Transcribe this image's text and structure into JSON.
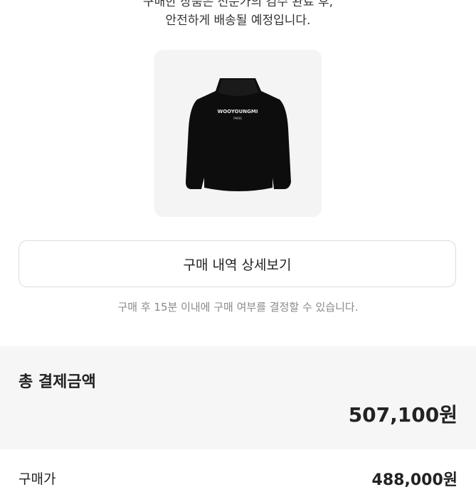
{
  "message": {
    "line1": "구매한 상품은 전문가의 검수 완료 후,",
    "line2": "안전하게 배송될 예정입니다."
  },
  "product": {
    "image_icon": "black-hoodie-image",
    "brand_text": "WOOYOUNGMI",
    "brand_subtext": "PARIS"
  },
  "detail_button": {
    "label": "구매 내역 상세보기"
  },
  "notice": "구매 후 15분 이내에 구매 여부를 결정할 수 있습니다.",
  "summary": {
    "total_label": "총 결제금액",
    "total_amount": "507,100원",
    "rows": [
      {
        "label": "구매가",
        "value": "488,000원"
      }
    ]
  }
}
